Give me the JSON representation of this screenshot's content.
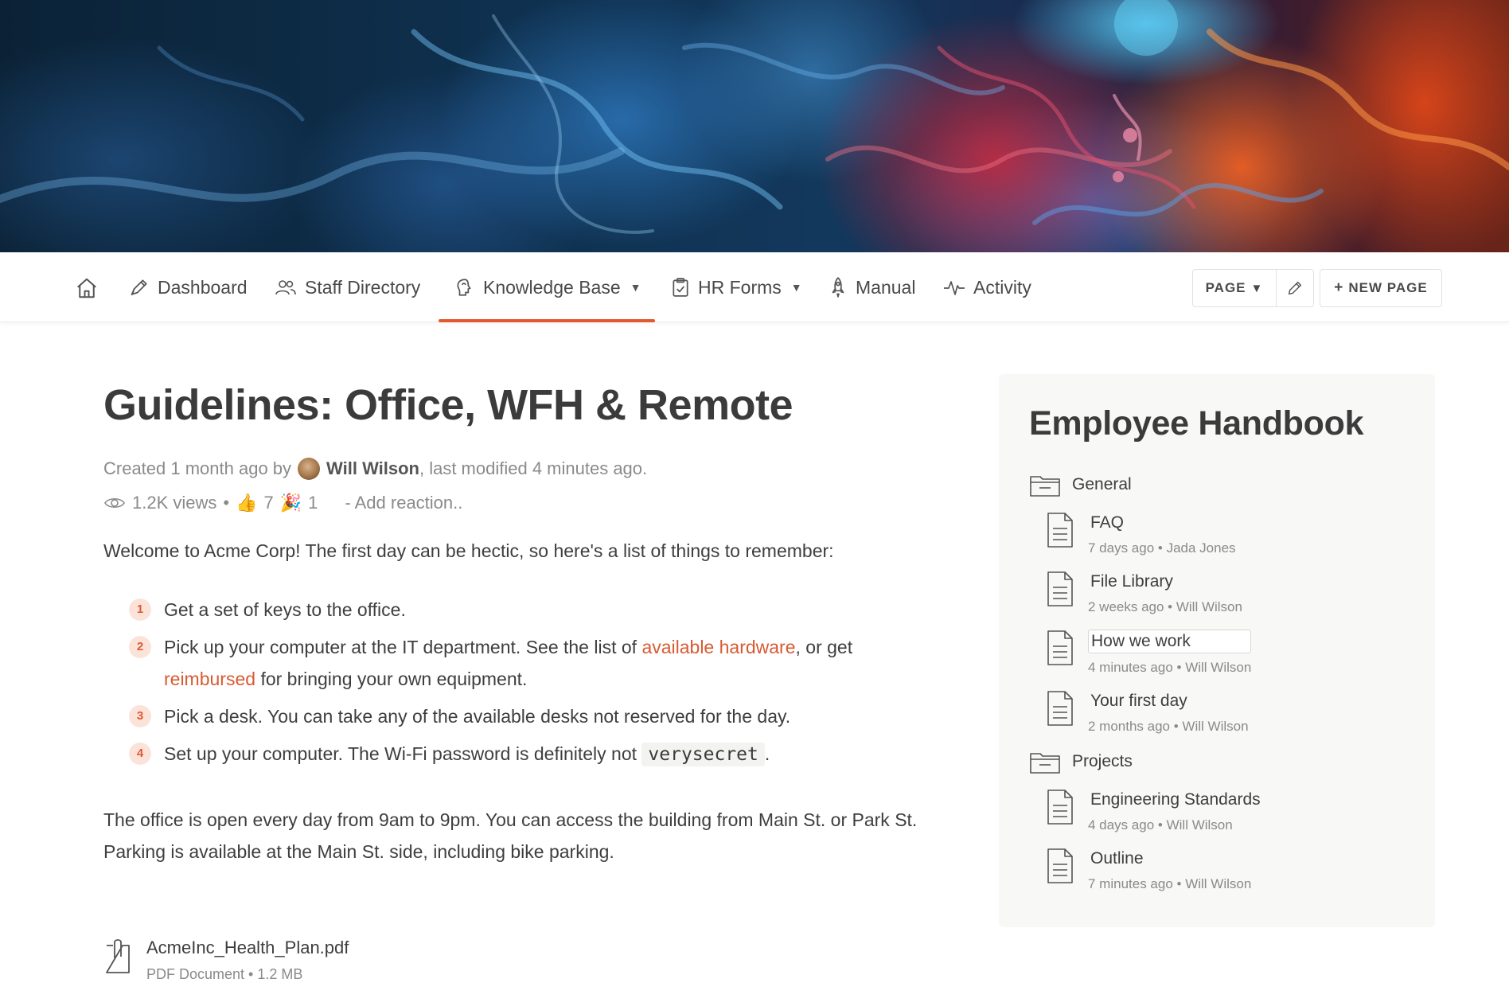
{
  "nav": {
    "items": [
      {
        "label": "Dashboard",
        "icon": "pen-icon"
      },
      {
        "label": "Staff Directory",
        "icon": "users-icon"
      },
      {
        "label": "Knowledge Base",
        "icon": "brain-icon",
        "dropdown": true,
        "active": true
      },
      {
        "label": "HR Forms",
        "icon": "clipboard-icon",
        "dropdown": true
      },
      {
        "label": "Manual",
        "icon": "rocket-icon"
      },
      {
        "label": "Activity",
        "icon": "pulse-icon"
      }
    ],
    "page_button": "PAGE",
    "new_page_button": "NEW PAGE",
    "accent_color": "#e2582f"
  },
  "page": {
    "title": "Guidelines: Office, WFH & Remote",
    "meta_created": "Created 1 month ago by",
    "author": "Will Wilson",
    "meta_modified": ", last modified 4 minutes ago.",
    "views": "1.2K views",
    "reaction_thumbs": "7",
    "reaction_party": "1",
    "add_reaction": "- Add reaction..",
    "intro": "Welcome to Acme Corp! The first day can be hectic, so here's a list of things to remember:",
    "steps": [
      {
        "num": "1",
        "text": "Get a set of keys to the office."
      },
      {
        "num": "2",
        "pre": "Pick up your computer at the IT department. See the list of",
        "link1": "available hardware",
        "mid": ", or get",
        "link2": "reimbursed",
        "post": "for bringing your own equipment."
      },
      {
        "num": "3",
        "text": "Pick a desk. You can take any of the available desks not reserved for the day."
      },
      {
        "num": "4",
        "pre": "Set up your computer. The Wi-Fi password is definitely not",
        "code": "verysecret",
        "post": "."
      }
    ],
    "hours": "The office is open every day from 9am to 9pm. You can access the building from Main St. or Park St. Parking is available at the Main St. side, including bike parking.",
    "attachment": {
      "name": "AcmeInc_Health_Plan.pdf",
      "type": "PDF Document",
      "size": "1.2 MB"
    }
  },
  "sidebar": {
    "title": "Employee Handbook",
    "folders": [
      {
        "name": "General",
        "docs": [
          {
            "title": "FAQ",
            "time": "7 days ago",
            "author": "Jada Jones"
          },
          {
            "title": "File Library",
            "time": "2 weeks ago",
            "author": "Will Wilson"
          },
          {
            "title": "How we work",
            "time": "4 minutes ago",
            "author": "Will Wilson"
          },
          {
            "title": "Your first day",
            "time": "2 months ago",
            "author": "Will Wilson"
          }
        ]
      },
      {
        "name": "Projects",
        "docs": [
          {
            "title": "Engineering Standards",
            "time": "4 days ago",
            "author": "Will Wilson"
          },
          {
            "title": "Outline",
            "time": "7 minutes ago",
            "author": "Will Wilson"
          }
        ]
      }
    ]
  }
}
